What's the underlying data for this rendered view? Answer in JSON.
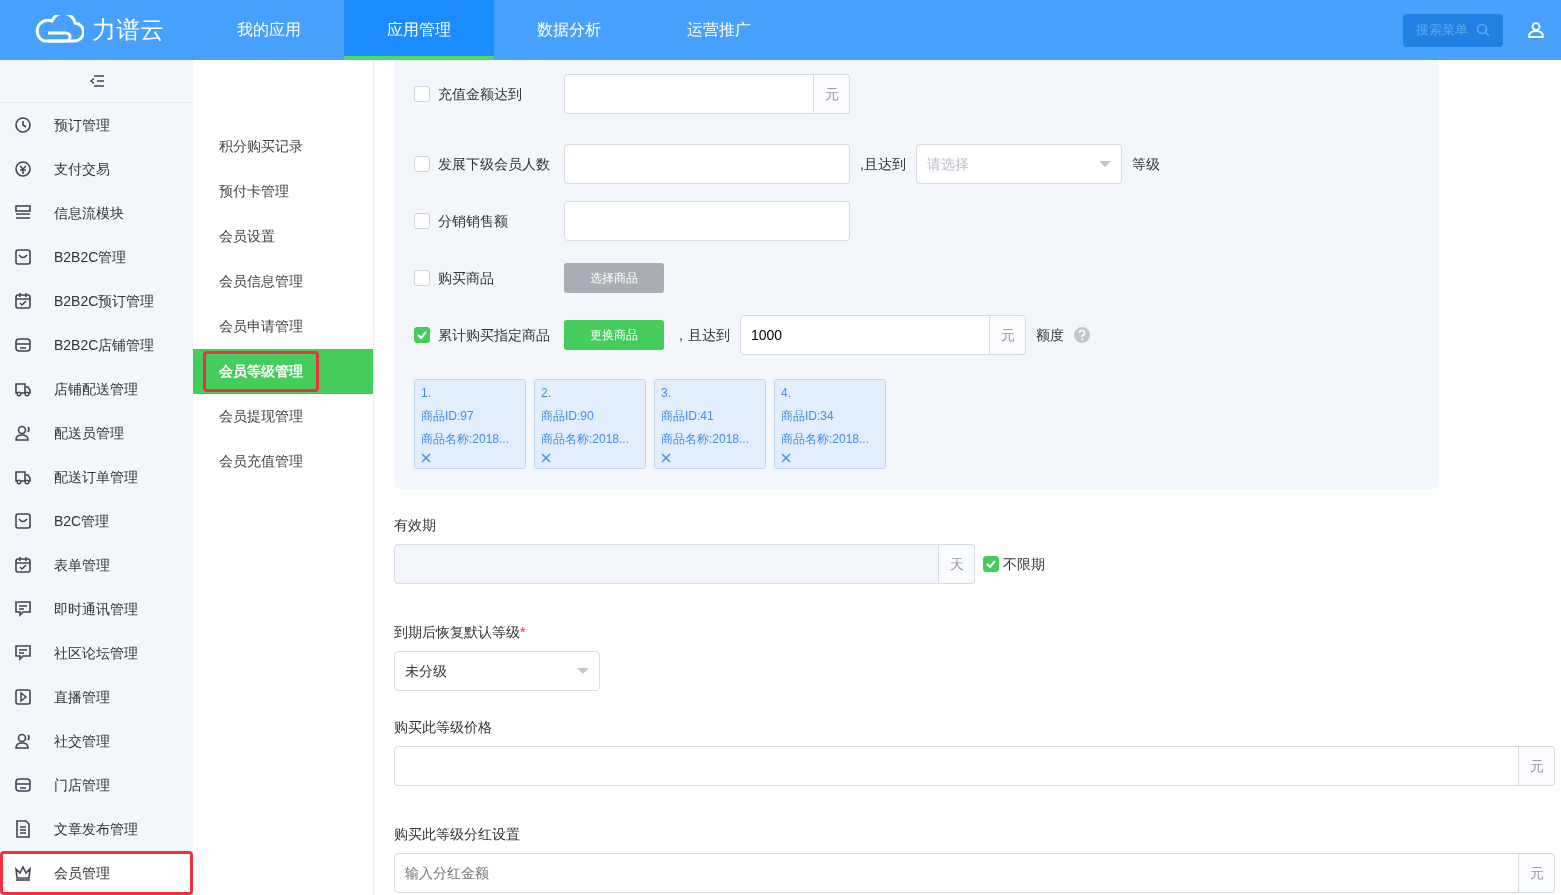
{
  "header": {
    "logo": "力谱云",
    "tabs": [
      {
        "label": "我的应用",
        "selected": false
      },
      {
        "label": "应用管理",
        "selected": true
      },
      {
        "label": "数据分析",
        "selected": false
      },
      {
        "label": "运营推广",
        "selected": false
      }
    ],
    "search_button": "搜索菜单"
  },
  "sidebar": {
    "items": [
      {
        "label": "预订管理",
        "selected": false,
        "annotated": false
      },
      {
        "label": "支付交易",
        "selected": false,
        "annotated": false
      },
      {
        "label": "信息流模块",
        "selected": false,
        "annotated": false
      },
      {
        "label": "B2B2C管理",
        "selected": false,
        "annotated": false
      },
      {
        "label": "B2B2C预订管理",
        "selected": false,
        "annotated": false
      },
      {
        "label": "B2B2C店铺管理",
        "selected": false,
        "annotated": false
      },
      {
        "label": "店铺配送管理",
        "selected": false,
        "annotated": false
      },
      {
        "label": "配送员管理",
        "selected": false,
        "annotated": false
      },
      {
        "label": "配送订单管理",
        "selected": false,
        "annotated": false
      },
      {
        "label": "B2C管理",
        "selected": false,
        "annotated": false
      },
      {
        "label": "表单管理",
        "selected": false,
        "annotated": false
      },
      {
        "label": "即时通讯管理",
        "selected": false,
        "annotated": false
      },
      {
        "label": "社区论坛管理",
        "selected": false,
        "annotated": false
      },
      {
        "label": "直播管理",
        "selected": false,
        "annotated": false
      },
      {
        "label": "社交管理",
        "selected": false,
        "annotated": false
      },
      {
        "label": "门店管理",
        "selected": false,
        "annotated": false
      },
      {
        "label": "文章发布管理",
        "selected": false,
        "annotated": false
      },
      {
        "label": "会员管理",
        "selected": true,
        "annotated": true
      }
    ]
  },
  "submenu": {
    "items": [
      {
        "label": "积分购买记录",
        "selected": false,
        "annotated": false
      },
      {
        "label": "预付卡管理",
        "selected": false,
        "annotated": false
      },
      {
        "label": "会员设置",
        "selected": false,
        "annotated": false
      },
      {
        "label": "会员信息管理",
        "selected": false,
        "annotated": false
      },
      {
        "label": "会员申请管理",
        "selected": false,
        "annotated": false
      },
      {
        "label": "会员等级管理",
        "selected": true,
        "annotated": true
      },
      {
        "label": "会员提现管理",
        "selected": false,
        "annotated": false
      },
      {
        "label": "会员充值管理",
        "selected": false,
        "annotated": false
      }
    ]
  },
  "conditions": [
    {
      "label": "充值金额达到",
      "checked": false,
      "controls": [
        {
          "kind": "input",
          "unit": "元"
        }
      ]
    },
    {
      "label": "发展下级会员人数",
      "checked": false,
      "controls": [
        {
          "kind": "input"
        },
        {
          "kind": "text",
          "text": ",且达到"
        },
        {
          "kind": "select",
          "placeholder": "请选择"
        },
        {
          "kind": "text",
          "text": "等级"
        }
      ]
    },
    {
      "label": "分销销售额",
      "checked": false,
      "controls": [
        {
          "kind": "input"
        }
      ]
    },
    {
      "label": "购买商品",
      "checked": false,
      "controls": [
        {
          "kind": "button",
          "text": "选择商品",
          "disabled": true
        }
      ]
    },
    {
      "label": "累计购买指定商品",
      "checked": true,
      "controls": [
        {
          "kind": "button",
          "text": "更换商品",
          "disabled": false
        },
        {
          "kind": "text",
          "text": "，且达到"
        },
        {
          "kind": "input",
          "value": "1000",
          "unit": "元"
        },
        {
          "kind": "text",
          "text": "额度"
        },
        {
          "kind": "help"
        }
      ]
    }
  ],
  "products": [
    {
      "number": "1.",
      "id": "商品ID:97",
      "name": "商品名称:2018..."
    },
    {
      "number": "2.",
      "id": "商品ID:90",
      "name": "商品名称:2018..."
    },
    {
      "number": "3.",
      "id": "商品ID:41",
      "name": "商品名称:2018..."
    },
    {
      "number": "4.",
      "id": "商品ID:34",
      "name": "商品名称:2018..."
    }
  ],
  "validity": {
    "label": "有效期",
    "unit": "天",
    "disabled": true,
    "unlimited": {
      "label": "不限期",
      "checked": true
    }
  },
  "restore_level": {
    "label": "到期后恢复默认等级",
    "required_mark": "*",
    "value": "未分级"
  },
  "price": {
    "label": "购买此等级价格",
    "unit": "元"
  },
  "dividend": {
    "label": "购买此等级分红设置",
    "placeholder": "输入分红金额",
    "unit": "元"
  }
}
